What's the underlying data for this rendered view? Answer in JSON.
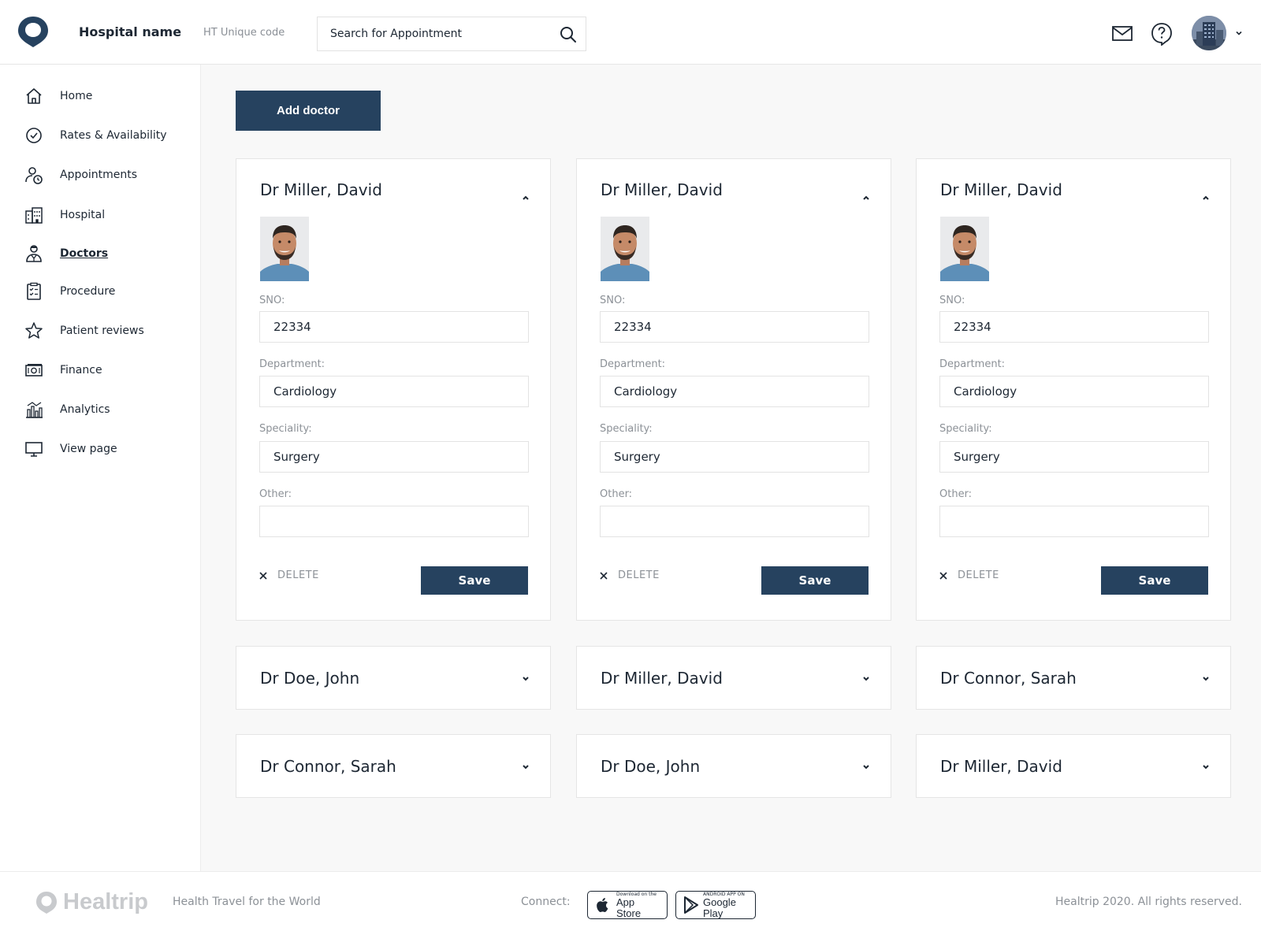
{
  "header": {
    "hospital_name": "Hospital name",
    "unique_code": "HT Unique code",
    "search_placeholder": "Search for Appointment"
  },
  "sidebar": {
    "items": [
      {
        "label": "Home",
        "icon": "home-icon"
      },
      {
        "label": "Rates & Availability",
        "icon": "check-circle-icon"
      },
      {
        "label": "Appointments",
        "icon": "user-clock-icon"
      },
      {
        "label": "Hospital",
        "icon": "building-icon"
      },
      {
        "label": "Doctors",
        "icon": "doctor-icon",
        "active": true
      },
      {
        "label": "Procedure",
        "icon": "clipboard-icon"
      },
      {
        "label": "Patient reviews",
        "icon": "star-icon"
      },
      {
        "label": "Finance",
        "icon": "cash-icon"
      },
      {
        "label": "Analytics",
        "icon": "chart-icon"
      },
      {
        "label": "View page",
        "icon": "monitor-icon"
      }
    ]
  },
  "main": {
    "add_doctor_label": "Add doctor",
    "field_labels": {
      "sno": "SNO:",
      "department": "Department:",
      "speciality": "Speciality:",
      "other": "Other:"
    },
    "delete_label": "DELETE",
    "save_label": "Save",
    "expanded_cards": [
      {
        "name": "Dr Miller, David",
        "sno": "22334",
        "department": "Cardiology",
        "speciality": "Surgery",
        "other": ""
      },
      {
        "name": "Dr Miller, David",
        "sno": "22334",
        "department": "Cardiology",
        "speciality": "Surgery",
        "other": ""
      },
      {
        "name": "Dr Miller, David",
        "sno": "22334",
        "department": "Cardiology",
        "speciality": "Surgery",
        "other": ""
      }
    ],
    "collapsed_cards": [
      {
        "name": "Dr Doe, John"
      },
      {
        "name": "Dr Miller, David"
      },
      {
        "name": "Dr Connor, Sarah"
      },
      {
        "name": "Dr Connor, Sarah"
      },
      {
        "name": "Dr Doe, John"
      },
      {
        "name": "Dr Miller, David"
      }
    ]
  },
  "footer": {
    "brand": "Healtrip",
    "tagline": "Health Travel for the World",
    "connect_label": "Connect:",
    "app_store_small": "Download on the",
    "app_store_big": "App Store",
    "google_play_small": "ANDROID APP ON",
    "google_play_big": "Google Play",
    "copyright": "Healtrip 2020. All rights reserved."
  },
  "colors": {
    "primary": "#26425f",
    "text": "#1d2733",
    "muted": "#8c9197",
    "background": "#f8f8f8"
  }
}
